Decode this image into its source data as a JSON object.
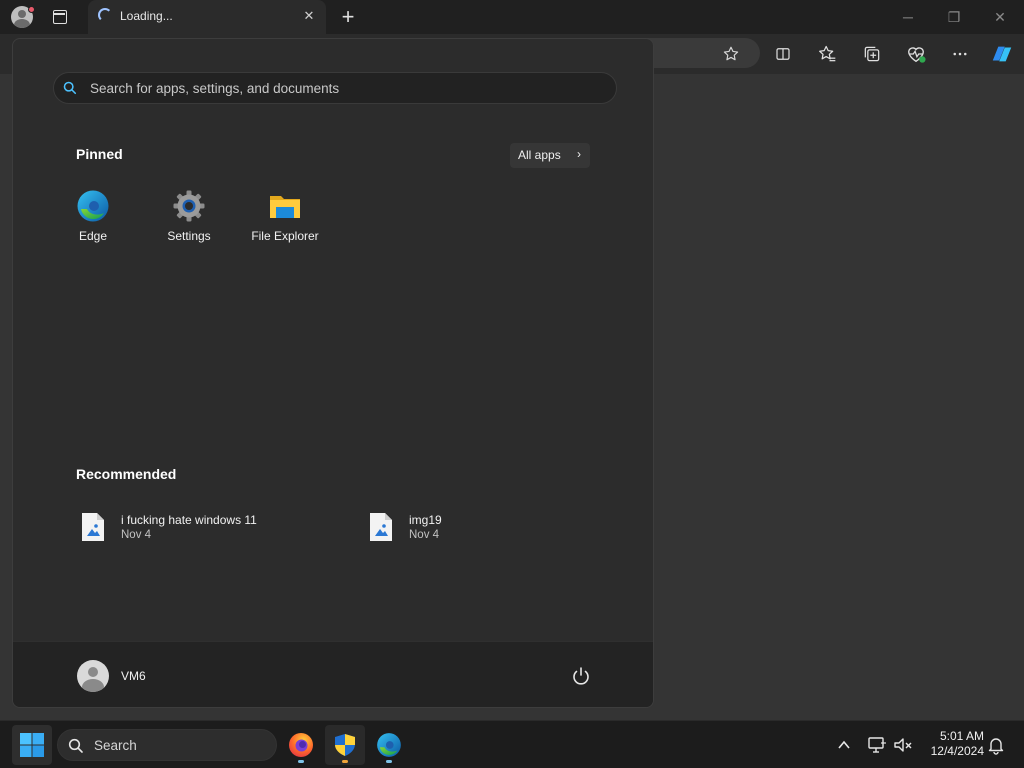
{
  "browser": {
    "tab": {
      "title": "Loading..."
    },
    "icons": [
      "profile-icon",
      "tab-actions-icon",
      "close-tab-icon",
      "new-tab-icon",
      "minimize-icon",
      "restore-icon",
      "close-icon",
      "favorite-star-icon",
      "split-screen-icon",
      "favorites-icon",
      "collections-icon",
      "browser-essentials-icon",
      "more-icon",
      "copilot-icon"
    ]
  },
  "start_menu": {
    "search_placeholder": "Search for apps, settings, and documents",
    "pinned_title": "Pinned",
    "all_apps_label": "All apps",
    "pinned_apps": [
      {
        "name": "Edge",
        "icon": "edge-icon"
      },
      {
        "name": "Settings",
        "icon": "settings-gear-icon"
      },
      {
        "name": "File Explorer",
        "icon": "folder-icon"
      }
    ],
    "recommended_title": "Recommended",
    "recommended": [
      {
        "name": "i fucking hate windows 11",
        "date": "Nov 4",
        "icon": "image-file-icon"
      },
      {
        "name": "img19",
        "date": "Nov 4",
        "icon": "image-file-icon"
      }
    ],
    "user": {
      "name": "VM6"
    },
    "power_icon": "power-icon"
  },
  "taskbar": {
    "search_label": "Search",
    "apps": [
      "firefox-icon",
      "security-shield-icon",
      "edge-icon"
    ],
    "clock": {
      "time": "5:01 AM",
      "date": "12/4/2024"
    }
  },
  "colors": {
    "accent": "#4cc2ff",
    "start_bg": "#2c2c2c",
    "taskbar_bg": "#1c1c1c"
  }
}
